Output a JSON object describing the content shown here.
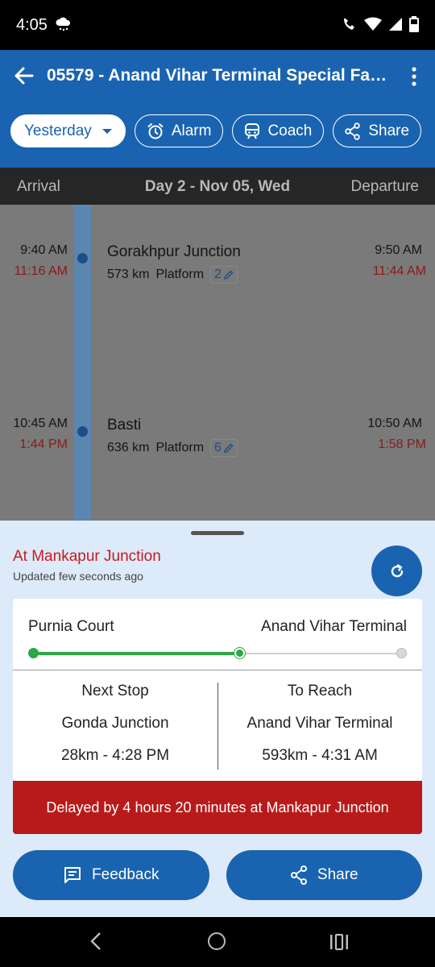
{
  "status_bar": {
    "time": "4:05"
  },
  "app_bar": {
    "title": "05579 - Anand Vihar Terminal Special Fare Special",
    "chips": {
      "date": "Yesterday",
      "alarm": "Alarm",
      "coach": "Coach",
      "share": "Share"
    }
  },
  "day_header": {
    "arrival": "Arrival",
    "day": "Day 2 - Nov 05, Wed",
    "departure": "Departure"
  },
  "stops": [
    {
      "name": "Gorakhpur Junction",
      "distance": "573 km",
      "platform_label": "Platform",
      "platform": "2",
      "arr_sched": "9:40 AM",
      "arr_actual": "11:16 AM",
      "dep_sched": "9:50 AM",
      "dep_actual": "11:44 AM"
    },
    {
      "name": "Basti",
      "distance": "636 km",
      "platform_label": "Platform",
      "platform": "6",
      "arr_sched": "10:45 AM",
      "arr_actual": "1:44 PM",
      "dep_sched": "10:50 AM",
      "dep_actual": "1:58 PM"
    }
  ],
  "live": {
    "status": "At Mankapur Junction",
    "updated": "Updated few seconds ago",
    "from": "Purnia Court",
    "to": "Anand Vihar Terminal",
    "progress_fraction": 0.56,
    "next_stop_label": "Next Stop",
    "next_stop": "Gonda Junction",
    "next_stop_eta": "28km - 4:28 PM",
    "to_reach_label": "To Reach",
    "to_reach": "Anand Vihar Terminal",
    "to_reach_eta": "593km - 4:31 AM",
    "delay": "Delayed by 4 hours 20 minutes at Mankapur Junction"
  },
  "actions": {
    "feedback": "Feedback",
    "share": "Share"
  },
  "colors": {
    "primary": "#1a63b0",
    "delay": "#b81a1a",
    "progress": "#2aa845",
    "late_time": "#c41c1c"
  }
}
